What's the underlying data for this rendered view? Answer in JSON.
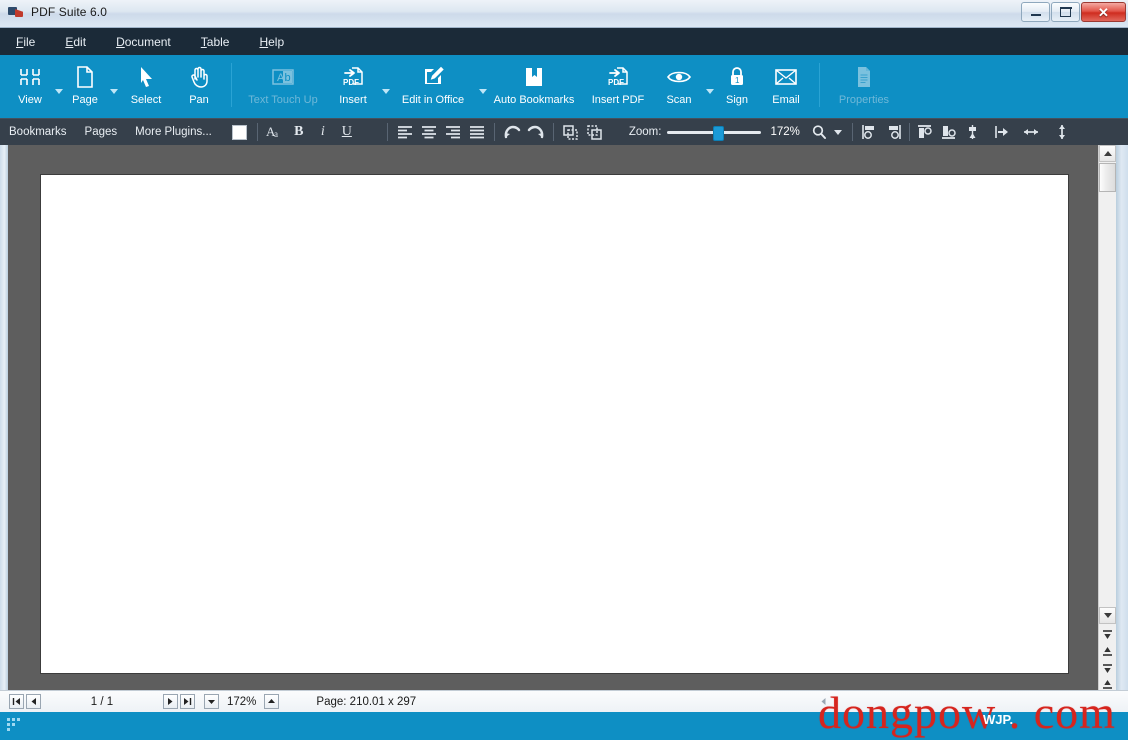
{
  "window": {
    "title": "PDF Suite 6.0",
    "logo_icon": "pdf-suite-logo-icon",
    "controls": {
      "minimize": "minimize-button",
      "maximize": "maximize-button",
      "close": "✕"
    }
  },
  "menubar": {
    "items": [
      {
        "label": "File",
        "accel": "F"
      },
      {
        "label": "Edit",
        "accel": "E"
      },
      {
        "label": "Document",
        "accel": "D"
      },
      {
        "label": "Table",
        "accel": "T"
      },
      {
        "label": "Help",
        "accel": "H"
      }
    ]
  },
  "ribbon": {
    "buttons": [
      {
        "label": "View",
        "icon": "view-grid-icon",
        "dropdown": true,
        "enabled": true
      },
      {
        "label": "Page",
        "icon": "page-document-icon",
        "dropdown": true,
        "enabled": true
      },
      {
        "label": "Select",
        "icon": "select-arrow-icon",
        "dropdown": false,
        "enabled": true
      },
      {
        "label": "Pan",
        "icon": "pan-hand-icon",
        "dropdown": false,
        "enabled": true
      },
      {
        "label": "Text Touch Up",
        "icon": "text-touchup-icon",
        "dropdown": false,
        "enabled": false
      },
      {
        "label": "Insert",
        "icon": "insert-pdf-arrow-icon",
        "dropdown": true,
        "enabled": true
      },
      {
        "label": "Edit in Office",
        "icon": "edit-pencil-icon",
        "dropdown": true,
        "enabled": true
      },
      {
        "label": "Auto Bookmarks",
        "icon": "bookmark-book-icon",
        "dropdown": false,
        "enabled": true
      },
      {
        "label": "Insert PDF",
        "icon": "insert-pdf-icon",
        "dropdown": false,
        "enabled": true
      },
      {
        "label": "Scan",
        "icon": "scan-eye-icon",
        "dropdown": true,
        "enabled": true
      },
      {
        "label": "Sign",
        "icon": "sign-lock-icon",
        "dropdown": false,
        "enabled": true
      },
      {
        "label": "Email",
        "icon": "email-envelope-icon",
        "dropdown": false,
        "enabled": true
      },
      {
        "label": "Properties",
        "icon": "properties-document-icon",
        "dropdown": false,
        "enabled": false
      }
    ]
  },
  "subtoolbar": {
    "plugins": [
      {
        "label": "Bookmarks"
      },
      {
        "label": "Pages"
      },
      {
        "label": "More Plugins..."
      }
    ],
    "color_swatch": "#ffffff",
    "text_tools": [
      {
        "icon": "font-size-icon",
        "label": "Font Size"
      },
      {
        "icon": "bold-icon",
        "label": "B"
      },
      {
        "icon": "italic-icon",
        "label": "I"
      },
      {
        "icon": "underline-icon",
        "label": "U"
      }
    ],
    "align_tools": [
      {
        "icon": "align-left-icon"
      },
      {
        "icon": "align-center-icon"
      },
      {
        "icon": "align-right-icon"
      },
      {
        "icon": "align-justify-icon"
      }
    ],
    "history_tools": [
      {
        "icon": "undo-icon"
      },
      {
        "icon": "redo-icon"
      }
    ],
    "object_tools": [
      {
        "icon": "bring-to-front-icon"
      },
      {
        "icon": "send-to-back-icon"
      }
    ],
    "zoom": {
      "label": "Zoom:",
      "value": "172%",
      "slider_percent": 48,
      "magnifier_icon": "magnifier-icon"
    },
    "arrange_tools": [
      {
        "icon": "align-objects-left-icon"
      },
      {
        "icon": "align-objects-right-icon"
      },
      {
        "icon": "align-objects-top-icon"
      },
      {
        "icon": "align-objects-bottom-icon"
      },
      {
        "icon": "center-vertical-icon"
      },
      {
        "icon": "center-horizontal-icon"
      },
      {
        "icon": "distribute-horizontal-icon"
      },
      {
        "icon": "distribute-vertical-icon"
      }
    ]
  },
  "workspace": {
    "canvas_color": "#5e5e5e",
    "page_color": "#ffffff",
    "vscrollbar": {
      "up_icon": "scroll-up-icon",
      "down_icon": "scroll-down-icon",
      "page_nav": [
        {
          "icon": "first-page-icon"
        },
        {
          "icon": "previous-page-icon"
        },
        {
          "icon": "next-page-icon"
        },
        {
          "icon": "last-page-icon"
        }
      ]
    }
  },
  "statusbar": {
    "nav": {
      "first_icon": "first-page-icon",
      "previous_icon": "previous-page-icon",
      "next_icon": "next-page-icon",
      "last_icon": "last-page-icon"
    },
    "page_indicator": "1 / 1",
    "zoom_value": "172%",
    "zoom_down_icon": "zoom-decrease-icon",
    "zoom_up_icon": "zoom-increase-icon",
    "page_size": "Page: 210.01 x 297",
    "hscroll_left_icon": "scroll-left-icon"
  },
  "bottombar": {
    "grip_icon": "resize-grip-icon",
    "accent_color": "#0e8fc4"
  },
  "watermark": {
    "text": "dongpow . com",
    "sub": "WJP.",
    "color": "#d6251e"
  }
}
